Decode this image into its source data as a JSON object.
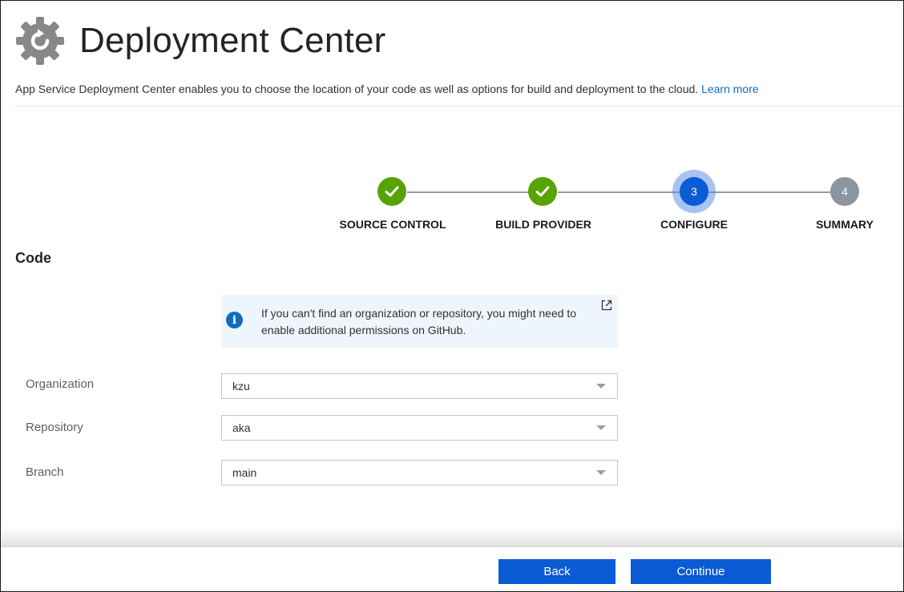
{
  "header": {
    "title": "Deployment Center",
    "icon": "gear-refresh-icon"
  },
  "description": {
    "text": "App Service Deployment Center enables you to choose the location of your code as well as options for build and deployment to the cloud.",
    "link_label": "Learn more"
  },
  "wizard": {
    "current_step": 3,
    "steps": [
      {
        "label": "SOURCE CONTROL",
        "status": "complete",
        "marker": "✓"
      },
      {
        "label": "BUILD PROVIDER",
        "status": "complete",
        "marker": "✓"
      },
      {
        "label": "CONFIGURE",
        "status": "active",
        "marker": "3"
      },
      {
        "label": "SUMMARY",
        "status": "pending",
        "marker": "4"
      }
    ]
  },
  "code_section": {
    "title": "Code",
    "info_message": "If you can't find an organization or repository, you might need to enable additional permissions on GitHub.",
    "fields": [
      {
        "label": "Organization",
        "value": "kzu"
      },
      {
        "label": "Repository",
        "value": "aka"
      },
      {
        "label": "Branch",
        "value": "main"
      }
    ]
  },
  "footer": {
    "back_label": "Back",
    "continue_label": "Continue"
  },
  "colors": {
    "accent": "#0b5bd5",
    "complete": "#57a300",
    "pending": "#8a95a0",
    "link": "#0f6cbd"
  }
}
